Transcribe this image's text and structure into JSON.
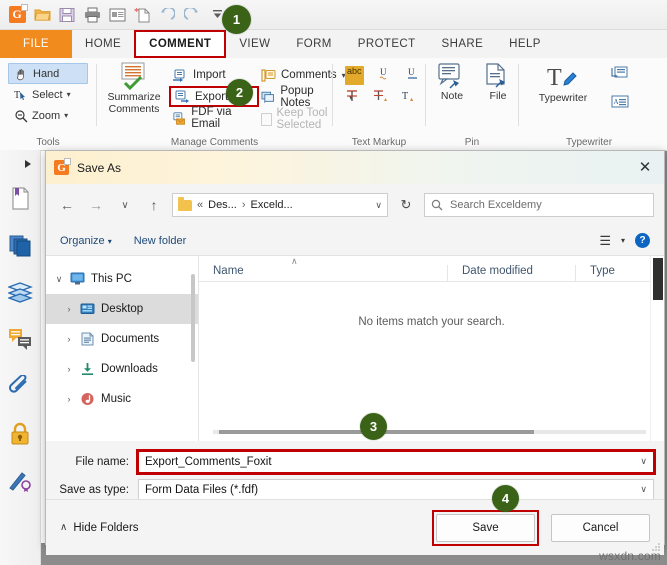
{
  "app": {
    "quick_access": [
      {
        "name": "foxit-logo-icon",
        "label": "Foxit"
      },
      {
        "name": "open-icon",
        "label": "Open"
      },
      {
        "name": "save-icon",
        "label": "Save"
      },
      {
        "name": "print-icon",
        "label": "Print"
      },
      {
        "name": "email-icon",
        "label": "Email"
      },
      {
        "name": "new-from-template-icon",
        "label": "New"
      },
      {
        "name": "undo-icon",
        "label": "Undo"
      },
      {
        "name": "redo-icon",
        "label": "Redo"
      },
      {
        "name": "customize-toolbar-icon",
        "label": "Customize"
      }
    ],
    "tabs": [
      {
        "label": "FILE"
      },
      {
        "label": "HOME"
      },
      {
        "label": "COMMENT"
      },
      {
        "label": "VIEW"
      },
      {
        "label": "FORM"
      },
      {
        "label": "PROTECT"
      },
      {
        "label": "SHARE"
      },
      {
        "label": "HELP"
      }
    ],
    "active_tab": "COMMENT",
    "ribbon": {
      "groups": [
        {
          "label": "Tools"
        },
        {
          "label": "Manage Comments"
        },
        {
          "label": "Text Markup"
        },
        {
          "label": "Pin"
        },
        {
          "label": "Typewriter"
        }
      ],
      "tools": [
        {
          "label": "Hand"
        },
        {
          "label": "Select"
        },
        {
          "label": "Zoom"
        }
      ],
      "summarize": {
        "line1": "Summarize",
        "line2": "Comments"
      },
      "manage": [
        {
          "label": "Import"
        },
        {
          "label": "Export"
        },
        {
          "label": "FDF via Email"
        },
        {
          "label": "Comments"
        },
        {
          "label": "Popup Notes"
        },
        {
          "label": "Keep Tool Selected"
        }
      ],
      "text_markup": {
        "abc_label": "abc"
      },
      "pin": [
        {
          "label": "Note"
        },
        {
          "label": "File"
        }
      ],
      "typewriter": {
        "label": "Typewriter"
      }
    },
    "left_panel_icons": [
      {
        "name": "bookmark-icon"
      },
      {
        "name": "page-thumbnails-icon"
      },
      {
        "name": "layers-icon"
      },
      {
        "name": "comments-panel-icon"
      },
      {
        "name": "attachments-icon"
      },
      {
        "name": "security-lock-icon"
      },
      {
        "name": "digital-signature-icon"
      }
    ]
  },
  "dialog": {
    "title": "Save As",
    "close_label": "✕",
    "nav": {
      "back": "←",
      "forward": "→",
      "recent": "∨",
      "up": "↑",
      "breadcrumb_sep": "«",
      "breadcrumb": [
        "Des...",
        "Exceld..."
      ],
      "breadcrumb_arrow": "›",
      "dropdown": "∨",
      "refresh": "↻",
      "search_placeholder": "Search Exceldemy"
    },
    "commandbar": {
      "organize": "Organize",
      "new_folder": "New folder",
      "view_label": "☰",
      "view_caret": "▾",
      "help": "?"
    },
    "tree": [
      {
        "label": "This PC",
        "icon": "monitor-icon",
        "level": 0,
        "expander": "∨",
        "selected": false
      },
      {
        "label": "Desktop",
        "icon": "desktop-icon",
        "level": 1,
        "expander": "›",
        "selected": true
      },
      {
        "label": "Documents",
        "icon": "documents-icon",
        "level": 1,
        "expander": "›",
        "selected": false
      },
      {
        "label": "Downloads",
        "icon": "downloads-icon",
        "level": 1,
        "expander": "›",
        "selected": false
      },
      {
        "label": "Music",
        "icon": "music-icon",
        "level": 1,
        "expander": "›",
        "selected": false
      }
    ],
    "columns": [
      {
        "label": "Name"
      },
      {
        "label": "Date modified"
      },
      {
        "label": "Type"
      }
    ],
    "sort_caret": "∧",
    "empty_message": "No items match your search.",
    "fields": {
      "file_name_label": "File name:",
      "file_name_value": "Export_Comments_Foxit",
      "save_as_type_label": "Save as type:",
      "save_as_type_value": "Form Data Files (*.fdf)",
      "dropdown_glyph": "∨"
    },
    "footer": {
      "hide_folders": "Hide Folders",
      "hide_folders_caret": "∧",
      "save": "Save",
      "cancel": "Cancel"
    }
  },
  "annotations": {
    "badges": [
      {
        "text": "1"
      },
      {
        "text": "2"
      },
      {
        "text": "3"
      },
      {
        "text": "4"
      }
    ],
    "highlight_color": "#c00000",
    "badge_color": "#3b6317"
  },
  "watermark": "wsxdn.com"
}
